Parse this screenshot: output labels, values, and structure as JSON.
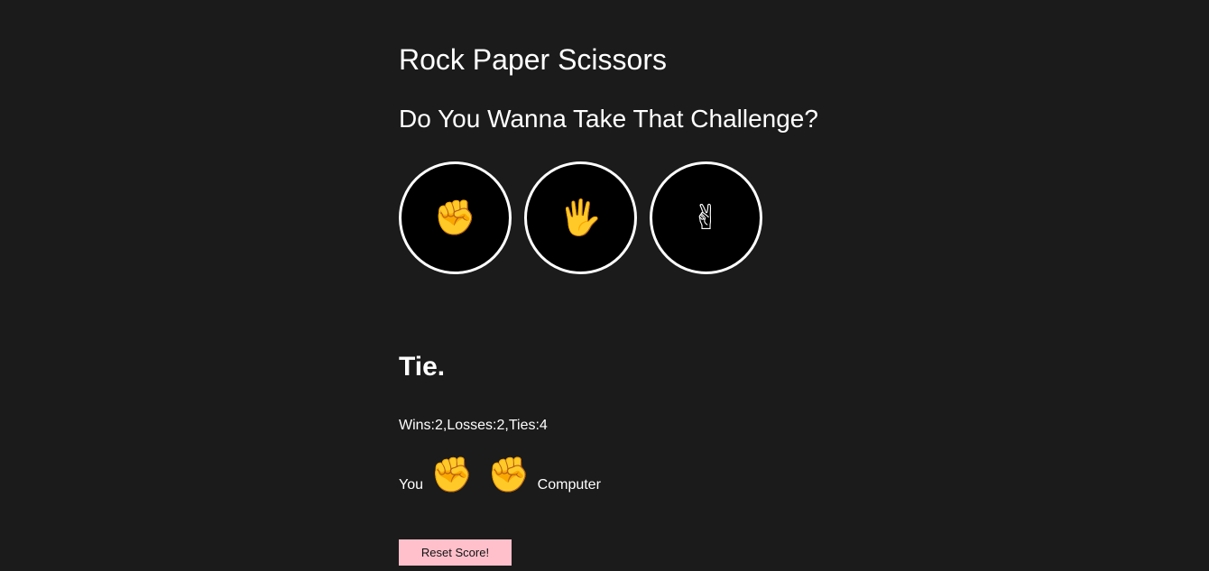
{
  "header": {
    "title": "Rock Paper Scissors",
    "subtitle": "Do You Wanna Take That Challenge?"
  },
  "choices": [
    {
      "name": "rock",
      "icon": "raised-fist-icon",
      "glyph": "✊"
    },
    {
      "name": "paper",
      "icon": "raised-hand-icon",
      "glyph": "🖐"
    },
    {
      "name": "scissors",
      "icon": "victory-hand-icon",
      "glyph": "✌"
    }
  ],
  "result": {
    "text": "Tie."
  },
  "score": {
    "text": "Wins:2,Losses:2,Ties:4"
  },
  "moves": {
    "you_label": "You",
    "you_glyph": "✊",
    "computer_glyph": "✊",
    "computer_label": "Computer"
  },
  "reset": {
    "label": "Reset Score!"
  },
  "colors": {
    "background": "#1b1b1b",
    "button_bg": "#000000",
    "button_border": "#ffffff",
    "reset_bg": "#ffc0cb"
  }
}
